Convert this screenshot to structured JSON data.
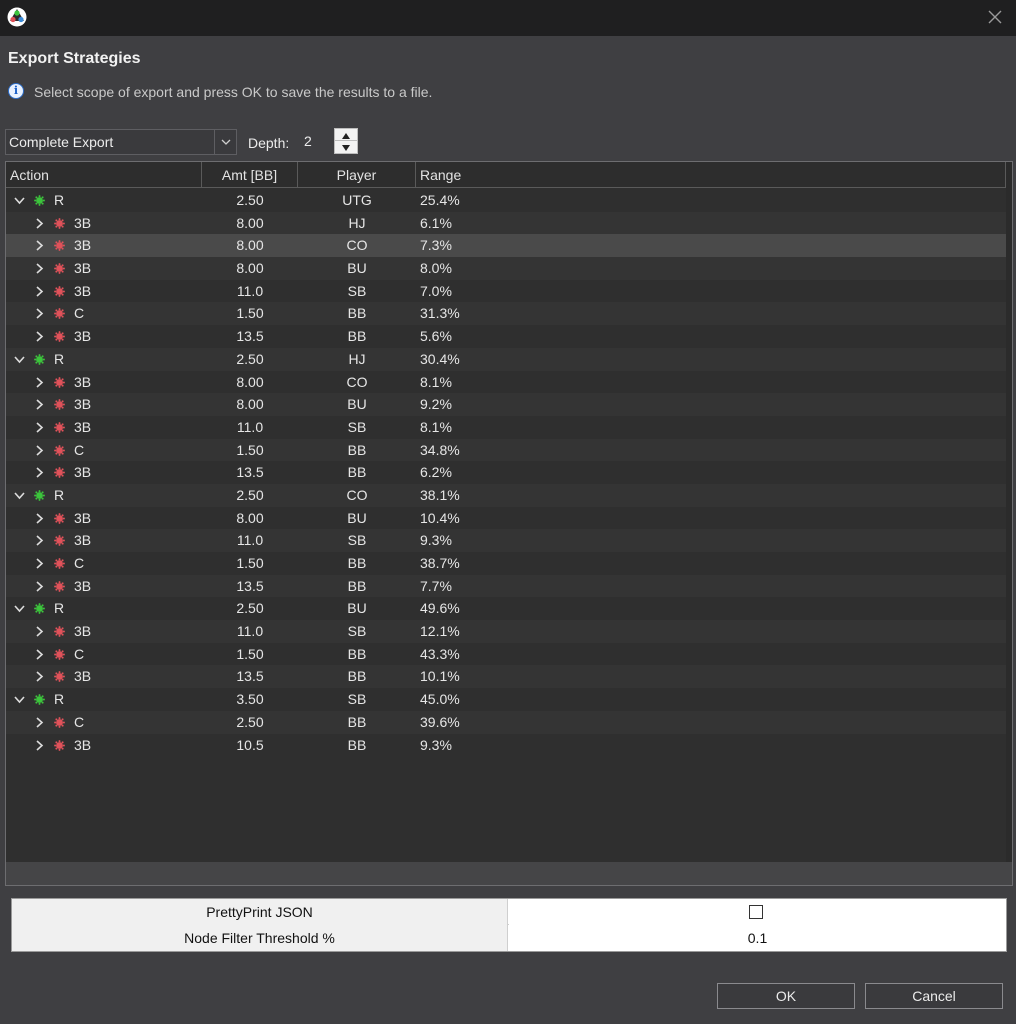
{
  "dialog": {
    "title": "Export Strategies",
    "info": "Select scope of export and press OK to save the results to a file."
  },
  "scope": {
    "selected": "Complete Export"
  },
  "depth": {
    "label": "Depth:",
    "value": "2"
  },
  "tree": {
    "columns": [
      "Action",
      "Amt [BB]",
      "Player",
      "Range"
    ],
    "rows": [
      {
        "level": 0,
        "expanded": true,
        "action": "R",
        "amt": "2.50",
        "player": "UTG",
        "range": "25.4%"
      },
      {
        "level": 1,
        "expanded": false,
        "action": "3B",
        "amt": "8.00",
        "player": "HJ",
        "range": "6.1%"
      },
      {
        "level": 1,
        "expanded": false,
        "action": "3B",
        "amt": "8.00",
        "player": "CO",
        "range": "7.3%",
        "selected": true
      },
      {
        "level": 1,
        "expanded": false,
        "action": "3B",
        "amt": "8.00",
        "player": "BU",
        "range": "8.0%"
      },
      {
        "level": 1,
        "expanded": false,
        "action": "3B",
        "amt": "11.0",
        "player": "SB",
        "range": "7.0%"
      },
      {
        "level": 1,
        "expanded": false,
        "action": "C",
        "amt": "1.50",
        "player": "BB",
        "range": "31.3%"
      },
      {
        "level": 1,
        "expanded": false,
        "action": "3B",
        "amt": "13.5",
        "player": "BB",
        "range": "5.6%"
      },
      {
        "level": 0,
        "expanded": true,
        "action": "R",
        "amt": "2.50",
        "player": "HJ",
        "range": "30.4%"
      },
      {
        "level": 1,
        "expanded": false,
        "action": "3B",
        "amt": "8.00",
        "player": "CO",
        "range": "8.1%"
      },
      {
        "level": 1,
        "expanded": false,
        "action": "3B",
        "amt": "8.00",
        "player": "BU",
        "range": "9.2%"
      },
      {
        "level": 1,
        "expanded": false,
        "action": "3B",
        "amt": "11.0",
        "player": "SB",
        "range": "8.1%"
      },
      {
        "level": 1,
        "expanded": false,
        "action": "C",
        "amt": "1.50",
        "player": "BB",
        "range": "34.8%"
      },
      {
        "level": 1,
        "expanded": false,
        "action": "3B",
        "amt": "13.5",
        "player": "BB",
        "range": "6.2%"
      },
      {
        "level": 0,
        "expanded": true,
        "action": "R",
        "amt": "2.50",
        "player": "CO",
        "range": "38.1%"
      },
      {
        "level": 1,
        "expanded": false,
        "action": "3B",
        "amt": "8.00",
        "player": "BU",
        "range": "10.4%"
      },
      {
        "level": 1,
        "expanded": false,
        "action": "3B",
        "amt": "11.0",
        "player": "SB",
        "range": "9.3%"
      },
      {
        "level": 1,
        "expanded": false,
        "action": "C",
        "amt": "1.50",
        "player": "BB",
        "range": "38.7%"
      },
      {
        "level": 1,
        "expanded": false,
        "action": "3B",
        "amt": "13.5",
        "player": "BB",
        "range": "7.7%"
      },
      {
        "level": 0,
        "expanded": true,
        "action": "R",
        "amt": "2.50",
        "player": "BU",
        "range": "49.6%"
      },
      {
        "level": 1,
        "expanded": false,
        "action": "3B",
        "amt": "11.0",
        "player": "SB",
        "range": "12.1%"
      },
      {
        "level": 1,
        "expanded": false,
        "action": "C",
        "amt": "1.50",
        "player": "BB",
        "range": "43.3%"
      },
      {
        "level": 1,
        "expanded": false,
        "action": "3B",
        "amt": "13.5",
        "player": "BB",
        "range": "10.1%"
      },
      {
        "level": 0,
        "expanded": true,
        "action": "R",
        "amt": "3.50",
        "player": "SB",
        "range": "45.0%"
      },
      {
        "level": 1,
        "expanded": false,
        "action": "C",
        "amt": "2.50",
        "player": "BB",
        "range": "39.6%"
      },
      {
        "level": 1,
        "expanded": false,
        "action": "3B",
        "amt": "10.5",
        "player": "BB",
        "range": "9.3%"
      }
    ]
  },
  "properties": {
    "pretty_print": {
      "label": "PrettyPrint JSON",
      "checked": false
    },
    "threshold": {
      "label": "Node Filter Threshold %",
      "value": "0.1"
    }
  },
  "buttons": {
    "ok": "OK",
    "cancel": "Cancel"
  },
  "colors": {
    "dot_root": "#3cc43c",
    "dot_child": "#e0525a"
  }
}
